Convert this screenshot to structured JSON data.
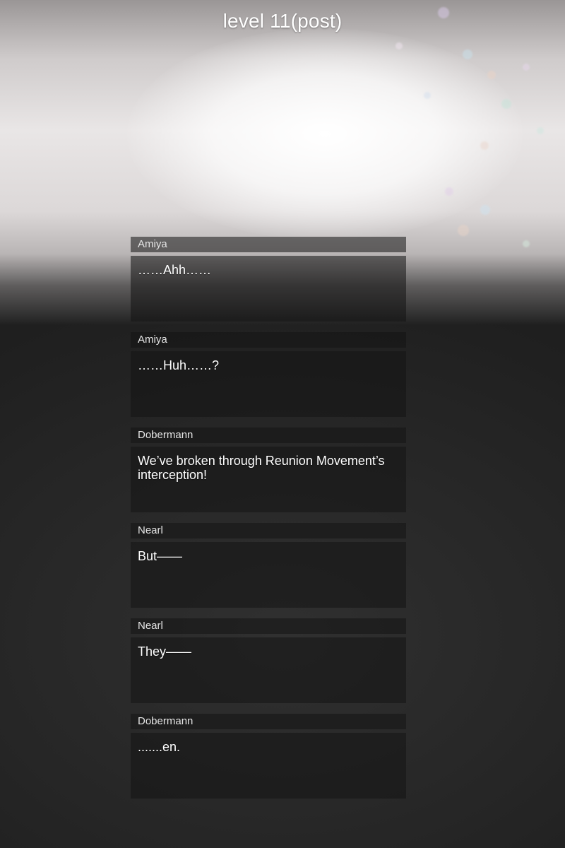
{
  "header": {
    "title": "level 11(post)"
  },
  "dialogue": [
    {
      "speaker": "Amiya",
      "text": "……Ahh……"
    },
    {
      "speaker": "Amiya",
      "text": "……Huh……?"
    },
    {
      "speaker": "Dobermann",
      "text": "We’ve broken through Reunion Movement’s interception!"
    },
    {
      "speaker": "Nearl",
      "text": "But——"
    },
    {
      "speaker": "Nearl",
      "text": "They——"
    },
    {
      "speaker": "Dobermann",
      "text": ".......en."
    }
  ]
}
